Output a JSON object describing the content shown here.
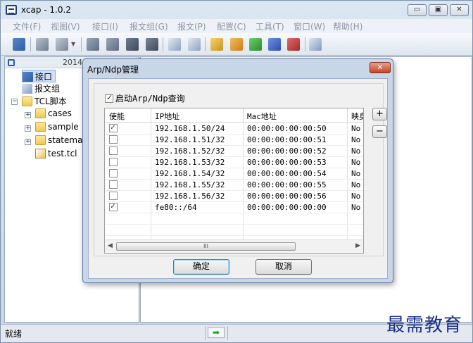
{
  "window": {
    "title": "xcap - 1.0.2",
    "controls": [
      "▭",
      "▣",
      "✕"
    ]
  },
  "menu": [
    {
      "label": "文件(F)"
    },
    {
      "label": "视图(V)"
    },
    {
      "label": "接口(I)"
    },
    {
      "label": "报文组(G)"
    },
    {
      "label": "报文(P)"
    },
    {
      "label": "配置(C)"
    },
    {
      "label": "工具(T)"
    },
    {
      "label": "窗口(W)"
    },
    {
      "label": "帮助(H)"
    }
  ],
  "tree": {
    "date": "2014-",
    "nodes": [
      {
        "label": "接口",
        "expander": ""
      },
      {
        "label": "报文组",
        "expander": ""
      },
      {
        "label": "TCL脚本",
        "expander": "−"
      },
      {
        "label": "cases",
        "expander": "+"
      },
      {
        "label": "sample",
        "expander": "+"
      },
      {
        "label": "statemac",
        "expander": "+"
      },
      {
        "label": "test.tcl",
        "expander": ""
      }
    ]
  },
  "status": {
    "text": "就绪",
    "arrow": "➡"
  },
  "watermark": "最需教育",
  "dialog": {
    "title": "Arp/Ndp管理",
    "close": "✕",
    "enable_label": "启动Arp/Ndp查询",
    "enabled": true,
    "columns": {
      "enable": "使能",
      "ip": "IP地址",
      "mac": "Mac地址",
      "map": "映身"
    },
    "rows": [
      {
        "checked": true,
        "ip": "192.168.1.50/24",
        "mac": "00:00:00:00:00:50",
        "map": "No"
      },
      {
        "checked": false,
        "ip": "192.168.1.51/32",
        "mac": "00:00:00:00:00:51",
        "map": "No"
      },
      {
        "checked": false,
        "ip": "192.168.1.52/32",
        "mac": "00:00:00:00:00:52",
        "map": "No"
      },
      {
        "checked": false,
        "ip": "192.168.1.53/32",
        "mac": "00:00:00:00:00:53",
        "map": "No"
      },
      {
        "checked": false,
        "ip": "192.168.1.54/32",
        "mac": "00:00:00:00:00:54",
        "map": "No"
      },
      {
        "checked": false,
        "ip": "192.168.1.55/32",
        "mac": "00:00:00:00:00:55",
        "map": "No"
      },
      {
        "checked": false,
        "ip": "192.168.1.56/32",
        "mac": "00:00:00:00:00:56",
        "map": "No"
      },
      {
        "checked": true,
        "ip": "fe80::/64",
        "mac": "00:00:00:00:00:00",
        "map": "No"
      }
    ],
    "scroll": {
      "left": "◀",
      "right": "▶",
      "thumb": "III"
    },
    "add_button": "+",
    "remove_button": "−",
    "ok_button": "确定",
    "cancel_button": "取消"
  }
}
